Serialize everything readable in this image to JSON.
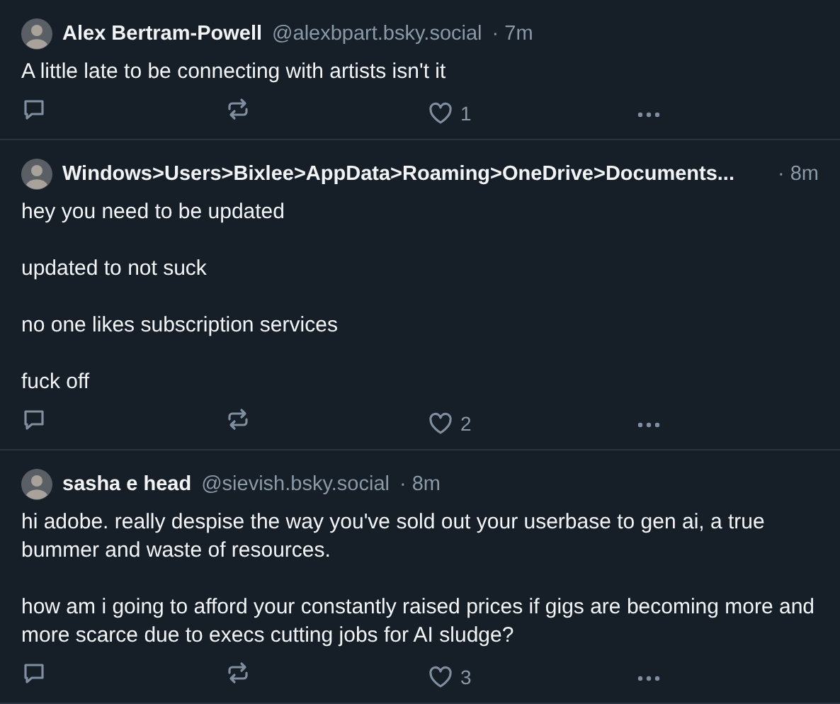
{
  "posts": [
    {
      "author": "Alex Bertram-Powell",
      "handle": "@alexbpart.bsky.social",
      "time": "· 7m",
      "paragraphs": [
        "A little late to be connecting with artists isn't it"
      ],
      "likes": "1"
    },
    {
      "author": "Windows>Users>Bixlee>AppData>Roaming>OneDrive>Documents...",
      "time": "· 8m",
      "paragraphs": [
        "hey you need to be updated",
        "updated to not suck",
        "no one likes subscription services",
        "fuck off"
      ],
      "likes": "2"
    },
    {
      "author": "sasha e head",
      "handle": "@sievish.bsky.social",
      "time": "· 8m",
      "paragraphs": [
        "hi adobe. really despise the way you've sold out your userbase to gen ai, a true bummer and waste of resources.",
        "how am i going to afford your constantly raised prices if gigs are becoming more and more scarce due to execs cutting jobs for AI sludge?"
      ],
      "likes": "3"
    }
  ]
}
